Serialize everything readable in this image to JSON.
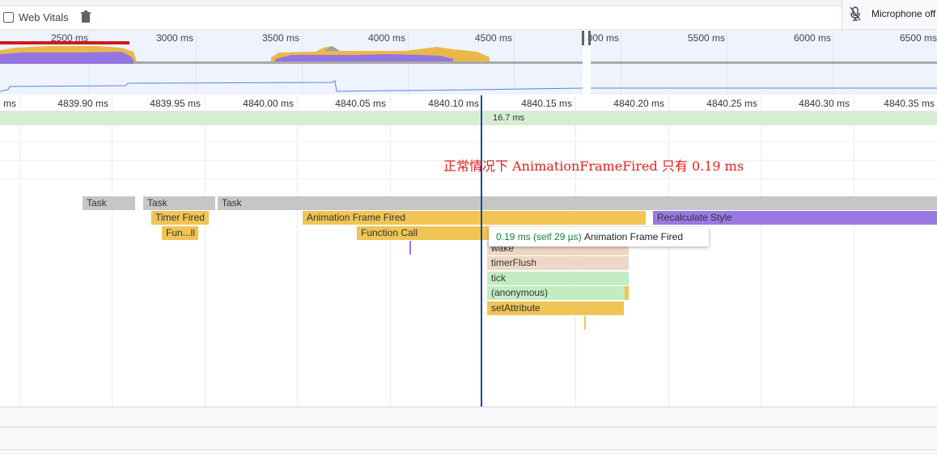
{
  "toolbar": {
    "web_vitals_label": "Web Vitals",
    "microphone_label": "Microphone off"
  },
  "overview": {
    "ticks": [
      "2500 ms",
      "3000 ms",
      "3500 ms",
      "4000 ms",
      "4500 ms",
      "5000 ms",
      "5500 ms",
      "6000 ms",
      "6500 ms"
    ]
  },
  "ruler": {
    "ticks": [
      "ms",
      "4839.90 ms",
      "4839.95 ms",
      "4840.00 ms",
      "4840.05 ms",
      "4840.10 ms",
      "4840.15 ms",
      "4840.20 ms",
      "4840.25 ms",
      "4840.30 ms",
      "4840.35 ms"
    ]
  },
  "frames": {
    "label": "16.7 ms"
  },
  "annotation": "正常情况下 AnimationFrameFired 只有 0.19 ms",
  "flame": {
    "task1": "Task",
    "task2": "Task",
    "task3": "Task",
    "timer_fired": "Timer Fired",
    "fun_ll": "Fun...ll",
    "animation_frame_fired": "Animation Frame Fired",
    "function_call": "Function Call",
    "recalculate_style": "Recalculate Style",
    "wake": "wake",
    "timer_flush": "timerFlush",
    "tick": "tick",
    "anonymous": "(anonymous)",
    "set_attribute": "setAttribute"
  },
  "tooltip": {
    "time": "0.19 ms (self 29 µs)",
    "name": "Animation Frame Fired"
  },
  "colors": {
    "task": "#c6c6c6",
    "scripting": "#f0c455",
    "rendering": "#9a78e4",
    "frame": "#d6edd4",
    "annotation": "#e0201e",
    "cursor": "#1a47a3"
  }
}
